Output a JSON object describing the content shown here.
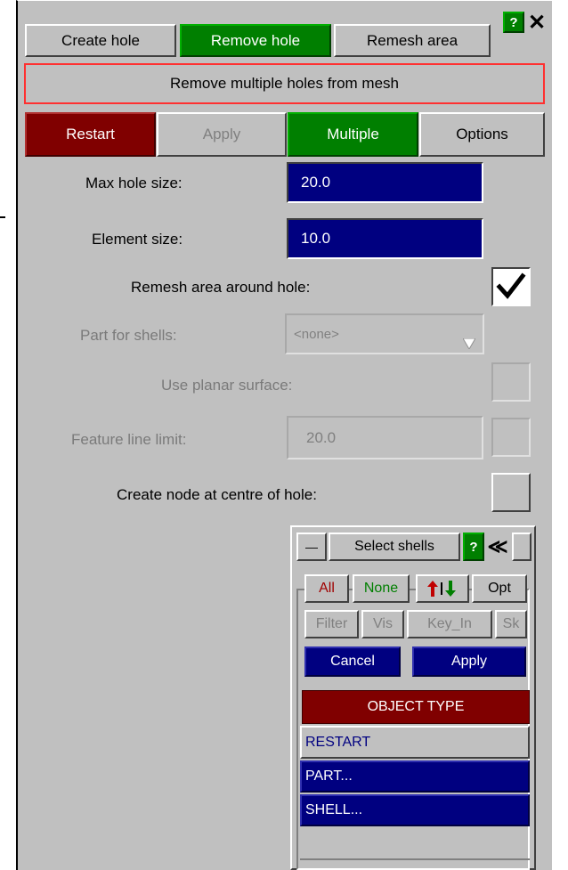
{
  "tabs": [
    {
      "label": "Create hole"
    },
    {
      "label": "Remove hole"
    },
    {
      "label": "Remesh area"
    }
  ],
  "header": {
    "help": "?",
    "close": "✕"
  },
  "banner": "Remove multiple holes from mesh",
  "toolbar": {
    "restart": "Restart",
    "apply": "Apply",
    "multiple": "Multiple",
    "options": "Options"
  },
  "form": {
    "max_hole_label": "Max hole size:",
    "max_hole_value": "20.0",
    "element_size_label": "Element size:",
    "element_size_value": "10.0",
    "remesh_label": "Remesh area around hole:",
    "remesh_checked": true,
    "part_label": "Part for shells:",
    "part_value": "<none>",
    "planar_label": "Use planar surface:",
    "feature_label": "Feature line limit:",
    "feature_value": "20.0",
    "centre_node_label": "Create node at centre of hole:"
  },
  "select_panel": {
    "title": "Select shells",
    "help": "?",
    "collapse": "≪",
    "minimize": "—",
    "all": "All",
    "none": "None",
    "opt": "Opt",
    "filter": "Filter",
    "vis": "Vis",
    "key_in": "Key_In",
    "sk": "Sk",
    "cancel": "Cancel",
    "apply": "Apply",
    "object_type_header": "OBJECT TYPE",
    "items": [
      {
        "label": "RESTART"
      },
      {
        "label": "PART..."
      },
      {
        "label": "SHELL..."
      }
    ]
  },
  "colors": {
    "panel": "#c0c0c0",
    "green": "#007f00",
    "red": "#800000",
    "navy": "#000080",
    "banner_border": "#ff3030"
  }
}
